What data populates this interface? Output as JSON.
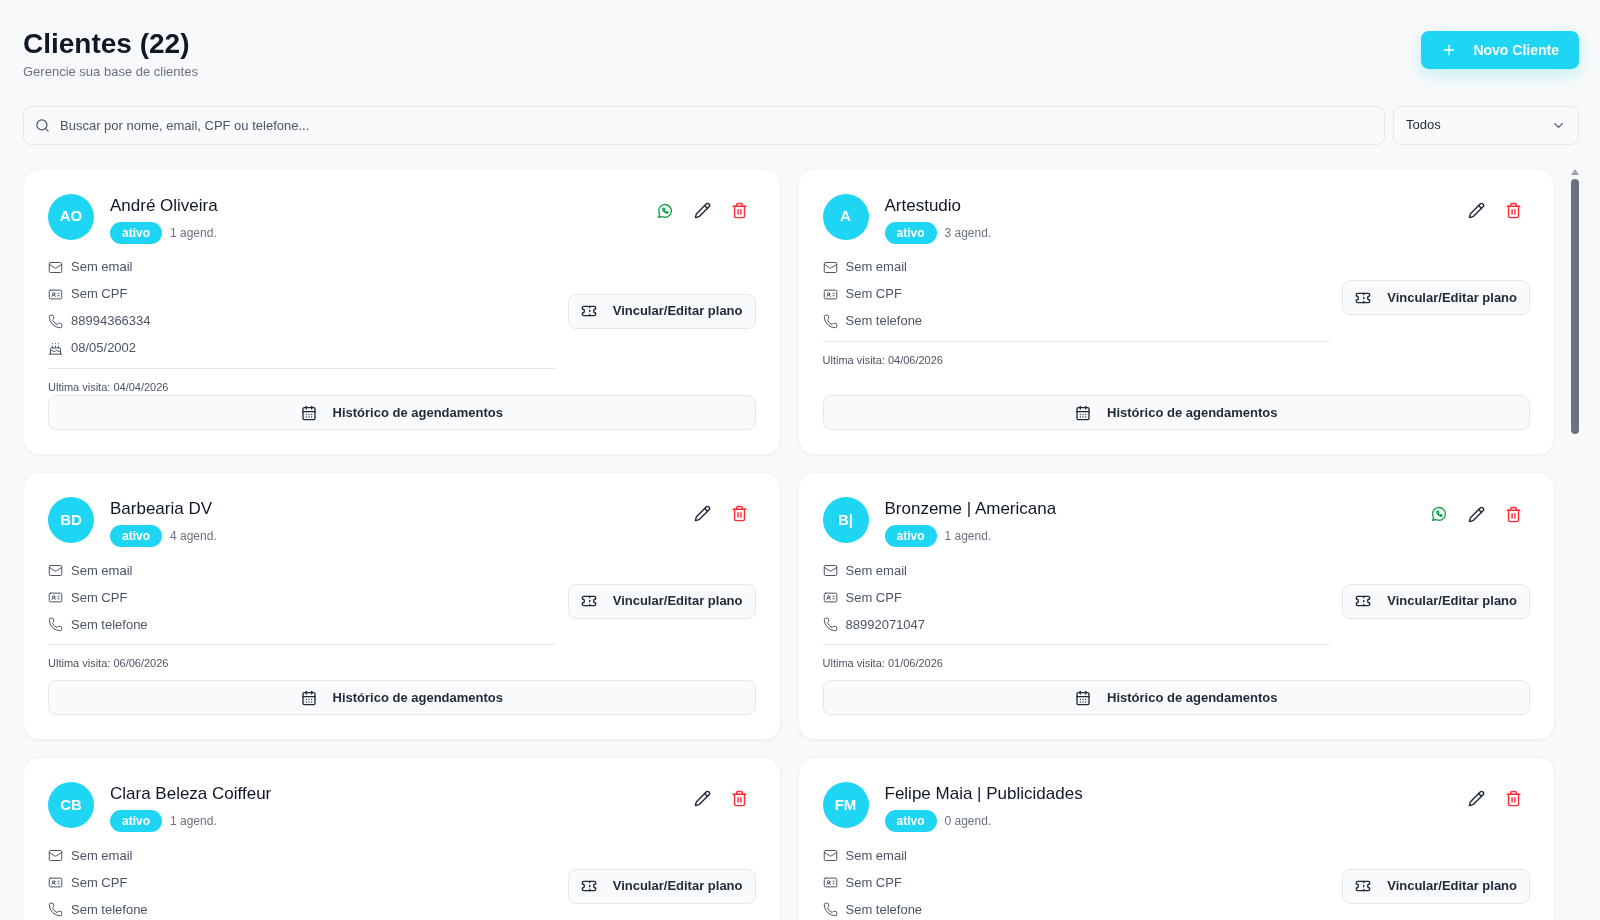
{
  "header": {
    "title": "Clientes (22)",
    "subtitle": "Gerencie sua base de clientes",
    "new_button": "Novo Cliente"
  },
  "search": {
    "placeholder": "Buscar por nome, email, CPF ou telefone..."
  },
  "filter": {
    "value": "Todos"
  },
  "clients": [
    {
      "initials": "AO",
      "name": "André Oliveira",
      "status": "ativo",
      "appointments": "1 agend.",
      "whatsapp": true,
      "info": [
        {
          "kind": "email",
          "text": "Sem email"
        },
        {
          "kind": "cpf",
          "text": "Sem CPF"
        },
        {
          "kind": "phone",
          "text": "88994366334"
        },
        {
          "kind": "birthday",
          "text": "08/05/2002"
        }
      ],
      "plan_button": "Vincular/Editar plano",
      "last_visit": "Ultima visita: 04/04/2026",
      "history_button": "Histórico de agendamentos"
    },
    {
      "initials": "A",
      "name": "Artestudio",
      "status": "ativo",
      "appointments": "3 agend.",
      "whatsapp": false,
      "info": [
        {
          "kind": "email",
          "text": "Sem email"
        },
        {
          "kind": "cpf",
          "text": "Sem CPF"
        },
        {
          "kind": "phone",
          "text": "Sem telefone"
        }
      ],
      "plan_button": "Vincular/Editar plano",
      "last_visit": "Ultima visita: 04/06/2026",
      "history_button": "Histórico de agendamentos"
    },
    {
      "initials": "BD",
      "name": "Barbearia DV",
      "status": "ativo",
      "appointments": "4 agend.",
      "whatsapp": false,
      "info": [
        {
          "kind": "email",
          "text": "Sem email"
        },
        {
          "kind": "cpf",
          "text": "Sem CPF"
        },
        {
          "kind": "phone",
          "text": "Sem telefone"
        }
      ],
      "plan_button": "Vincular/Editar plano",
      "last_visit": "Ultima visita: 06/06/2026",
      "history_button": "Histórico de agendamentos"
    },
    {
      "initials": "B|",
      "name": "Bronzeme | Americana",
      "status": "ativo",
      "appointments": "1 agend.",
      "whatsapp": true,
      "info": [
        {
          "kind": "email",
          "text": "Sem email"
        },
        {
          "kind": "cpf",
          "text": "Sem CPF"
        },
        {
          "kind": "phone",
          "text": "88992071047"
        }
      ],
      "plan_button": "Vincular/Editar plano",
      "last_visit": "Ultima visita: 01/06/2026",
      "history_button": "Histórico de agendamentos"
    },
    {
      "initials": "CB",
      "name": "Clara Beleza Coiffeur",
      "status": "ativo",
      "appointments": "1 agend.",
      "whatsapp": false,
      "info": [
        {
          "kind": "email",
          "text": "Sem email"
        },
        {
          "kind": "cpf",
          "text": "Sem CPF"
        },
        {
          "kind": "phone",
          "text": "Sem telefone"
        }
      ],
      "plan_button": "Vincular/Editar plano"
    },
    {
      "initials": "FM",
      "name": "Felipe Maia | Publicidades",
      "status": "ativo",
      "appointments": "0 agend.",
      "whatsapp": false,
      "info": [
        {
          "kind": "email",
          "text": "Sem email"
        },
        {
          "kind": "cpf",
          "text": "Sem CPF"
        },
        {
          "kind": "phone",
          "text": "Sem telefone"
        }
      ],
      "plan_button": "Vincular/Editar plano"
    }
  ]
}
